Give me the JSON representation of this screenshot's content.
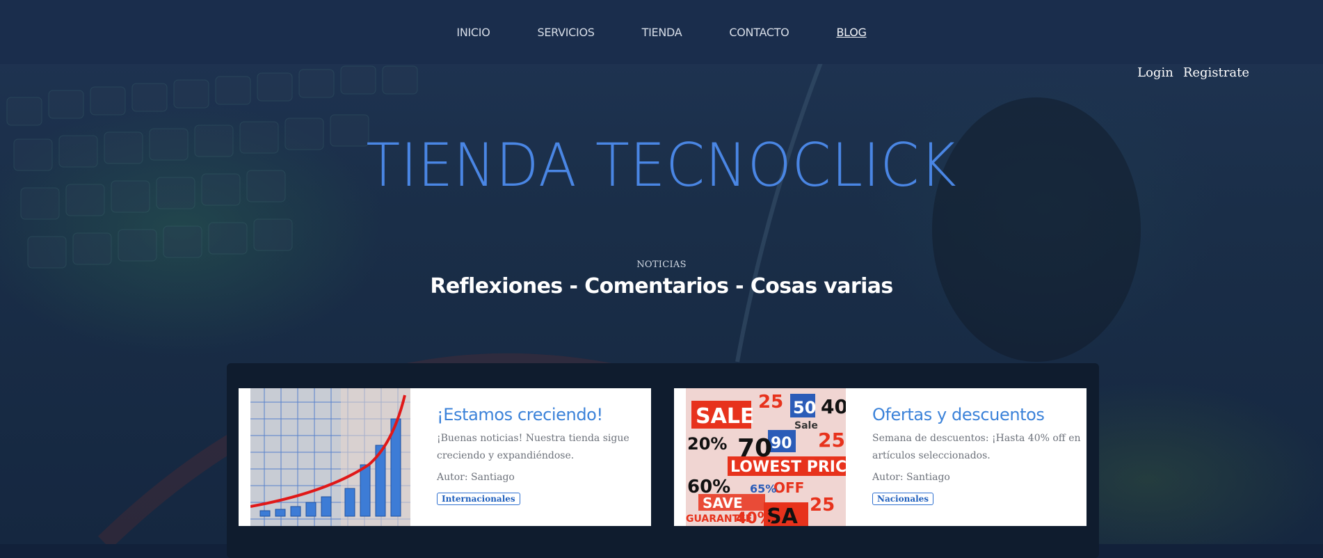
{
  "nav": {
    "items": [
      {
        "label": "INICIO"
      },
      {
        "label": "SERVICIOS"
      },
      {
        "label": "TIENDA"
      },
      {
        "label": "CONTACTO"
      },
      {
        "label": "BLOG"
      }
    ],
    "active": "BLOG"
  },
  "auth": {
    "login_label": "Login",
    "register_label": "Registrate"
  },
  "hero": {
    "title": "TIENDA TECNOCLICK",
    "section_tag": "NOTICIAS",
    "section_heading": "Reflexiones - Comentarios - Cosas varias"
  },
  "posts": [
    {
      "title": "¡Estamos creciendo!",
      "excerpt": "¡Buenas noticias! Nuestra tienda sigue creciendo y expandiéndose.",
      "author": "Autor: Santiago",
      "tag": "Internacionales",
      "image_icon": "growth-chart-image"
    },
    {
      "title": "Ofertas y descuentos",
      "excerpt": "Semana de descuentos: ¡Hasta 40% off en artículos seleccionados.",
      "author": "Autor: Santiago",
      "tag": "Nacionales",
      "image_icon": "sale-collage-image"
    }
  ],
  "colors": {
    "navbar": "#1a2d4c",
    "title_blue": "#4a86e4",
    "post_title": "#3b82d9",
    "panel": "#0f1c2e"
  },
  "image_text": {
    "sale_words": [
      "SALE",
      "50",
      "40",
      "25",
      "20%",
      "90",
      "LOWEST PRIC",
      "70",
      "OFF",
      "60%",
      "SAVE",
      "65%",
      "SA",
      "GUARANTEE",
      "40%",
      "SALE",
      "Sale"
    ]
  }
}
